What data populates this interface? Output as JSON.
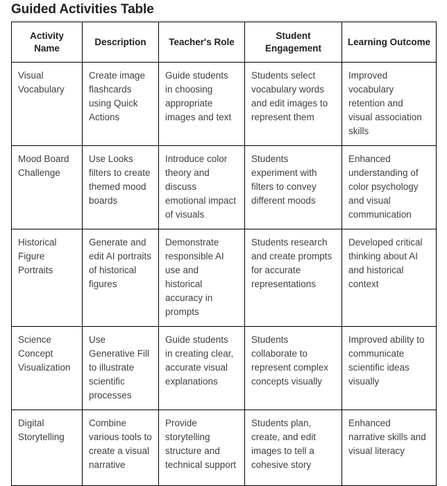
{
  "page": {
    "title": "Guided Activities Table"
  },
  "table": {
    "headers": [
      "Activity Name",
      "Description",
      "Teacher's Role",
      "Student Engagement",
      "Learning Outcome"
    ],
    "rows": [
      {
        "activity_name": "Visual Vocabulary",
        "description": "Create image flashcards using Quick Actions",
        "teachers_role": "Guide students in choosing appropriate images and text",
        "student_engagement": "Students select vocabulary words and edit images to represent them",
        "learning_outcome": "Improved vocabulary retention and visual association skills"
      },
      {
        "activity_name": "Mood Board Challenge",
        "description": "Use Looks filters to create themed mood boards",
        "teachers_role": "Introduce color theory and discuss emotional impact of visuals",
        "student_engagement": "Students experiment with filters to convey different moods",
        "learning_outcome": "Enhanced understanding of color psychology and visual communication"
      },
      {
        "activity_name": "Historical Figure Portraits",
        "description": "Generate and edit AI portraits of historical figures",
        "teachers_role": "Demonstrate responsible AI use and historical accuracy in prompts",
        "student_engagement": "Students research and create prompts for accurate representations",
        "learning_outcome": "Developed critical thinking about AI and historical context"
      },
      {
        "activity_name": "Science Concept Visualization",
        "description": "Use Generative Fill to illustrate scientific processes",
        "teachers_role": "Guide students in creating clear, accurate visual explanations",
        "student_engagement": "Students collaborate to represent complex concepts visually",
        "learning_outcome": "Improved ability to communicate scientific ideas visually"
      },
      {
        "activity_name": "Digital Storytelling",
        "description": "Combine various tools to create a visual narrative",
        "teachers_role": "Provide storytelling structure and technical support",
        "student_engagement": "Students plan, create, and edit images to tell a cohesive story",
        "learning_outcome": "Enhanced narrative skills and visual literacy"
      }
    ]
  },
  "colors": {
    "border": "#000000",
    "header_text": "#202124",
    "body_text": "#3c4043",
    "background": "#ffffff"
  }
}
